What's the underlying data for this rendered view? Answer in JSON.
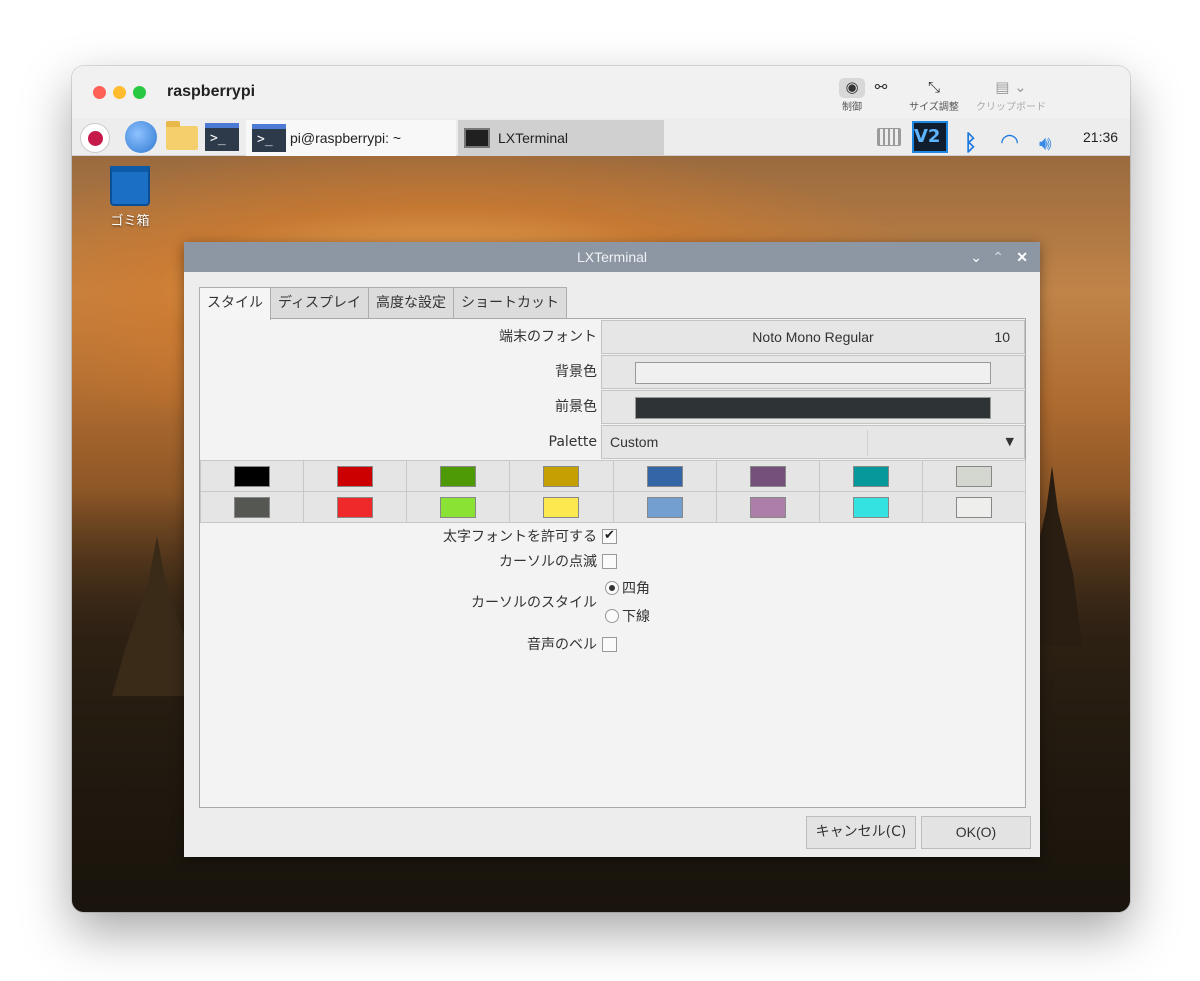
{
  "host": {
    "title": "raspberrypi",
    "tools": [
      {
        "icon": "pointer-icon",
        "label": "制御"
      },
      {
        "icon": "binoculars-icon",
        "label": ""
      },
      {
        "icon": "resize-icon",
        "label": "サイズ調整"
      },
      {
        "icon": "clipboard-icon",
        "label": "クリップボード"
      }
    ]
  },
  "taskbar": {
    "tasks": [
      {
        "label": "pi@raspberrypi: ~",
        "icon": "terminal-icon"
      },
      {
        "label": "LXTerminal",
        "icon": "monitor-icon"
      }
    ],
    "clock": "21:36",
    "vnc_label": "V2",
    "terminal_glyph": ">_"
  },
  "desktop": {
    "trash_label": "ゴミ箱"
  },
  "dialog": {
    "title": "LXTerminal",
    "tabs": [
      "スタイル",
      "ディスプレイ",
      "高度な設定",
      "ショートカット"
    ],
    "font_label": "端末のフォント",
    "font_name": "Noto Mono Regular",
    "font_size": "10",
    "bg_label": "背景色",
    "bg_color": "#f0f0f0",
    "fg_label": "前景色",
    "fg_color": "#2e3436",
    "palette_label": "Palette",
    "palette_value": "Custom",
    "palette_colors_row1": [
      "#000000",
      "#cc0000",
      "#4e9a06",
      "#c4a000",
      "#3465a4",
      "#75507b",
      "#06989a",
      "#d3d7cf"
    ],
    "palette_colors_row2": [
      "#555753",
      "#ef2929",
      "#8ae234",
      "#fce94f",
      "#729fcf",
      "#ad7fa8",
      "#34e2e2",
      "#eeeeec"
    ],
    "bold_label": "太字フォントを許可する",
    "bold_checked": true,
    "blink_label": "カーソルの点滅",
    "blink_checked": false,
    "cursor_style_label": "カーソルのスタイル",
    "cursor_style_options": [
      "四角",
      "下線"
    ],
    "cursor_style_selected": "四角",
    "bell_label": "音声のベル",
    "bell_checked": false,
    "cancel_label": "キャンセル(C)",
    "ok_label": "OK(O)"
  }
}
